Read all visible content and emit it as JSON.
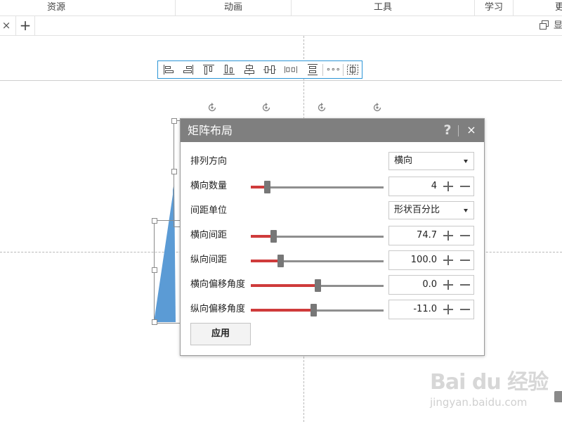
{
  "menu": {
    "items": [
      "资源",
      "动画",
      "工具",
      "学习",
      "更"
    ]
  },
  "tabbar": {
    "close_glyph": "×",
    "add_glyph": "+",
    "right_icon": "restore-window-icon",
    "right_text": "显"
  },
  "align_toolbar": {
    "buttons": [
      "align-left-icon",
      "align-right-icon",
      "align-top-icon",
      "align-bottom-icon",
      "align-center-vertical-icon",
      "distribute-horizontal-icon",
      "distribute-horizontal-evenly-icon",
      "distribute-vertical-icon",
      "more-icon",
      "matrix-layout-icon"
    ],
    "more_glyph": "∘∘∘"
  },
  "dialog": {
    "title": "矩阵布局",
    "help_glyph": "?",
    "close_glyph": "×",
    "rows": {
      "direction": {
        "label": "排列方向",
        "value": "横向"
      },
      "h_count": {
        "label": "横向数量",
        "value": "4",
        "slider": 0.12
      },
      "spacing_unit": {
        "label": "间距单位",
        "value": "形状百分比"
      },
      "h_spacing": {
        "label": "横向间距",
        "value": "74.7",
        "slider": 0.17
      },
      "v_spacing": {
        "label": "纵向间距",
        "value": "100.0",
        "slider": 0.22
      },
      "h_offset": {
        "label": "横向偏移角度",
        "value": "0.0",
        "slider": 0.5
      },
      "v_offset": {
        "label": "纵向偏移角度",
        "value": "-11.0",
        "slider": 0.47
      }
    },
    "apply_label": "应用"
  },
  "colors": {
    "accent_blue": "#2c95d6",
    "slider_fill": "#cf3b3b",
    "shape_fill": "#5b9bd5",
    "title_bar": "#7f7f7f"
  },
  "watermark": {
    "logo": "Bai du 经验",
    "url": "jingyan.baidu.com"
  }
}
